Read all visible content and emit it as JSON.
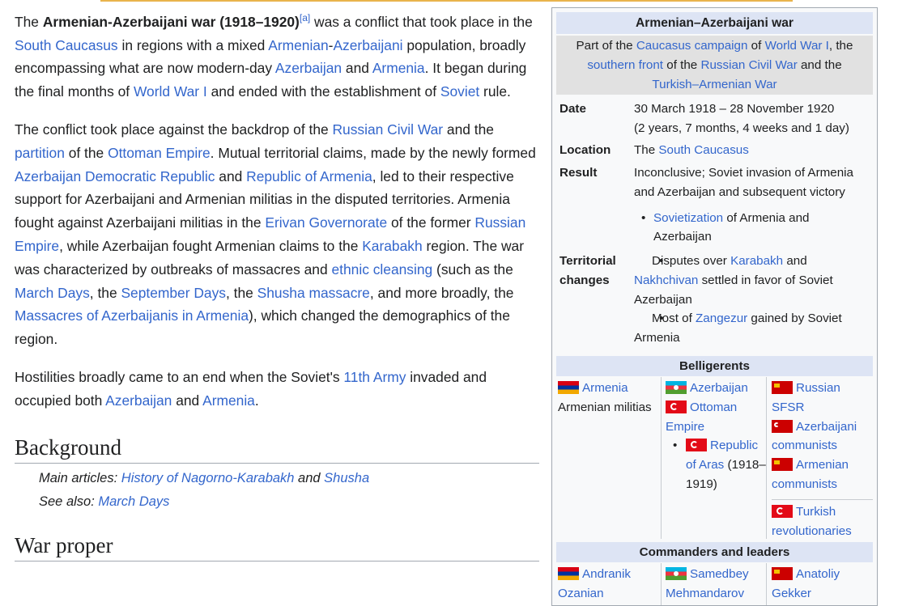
{
  "article": {
    "p1": {
      "t1": "The ",
      "bold": "Armenian-Azerbaijani war (1918–1920)",
      "note": "[a]",
      "t2": " was a conflict that took place in the ",
      "l_south_caucasus": "South Caucasus",
      "t3": " in regions with a mixed ",
      "l_armenian": "Armenian",
      "t4": "-",
      "l_azerbaijani": "Azerbaijani",
      "t5": " population, broadly encompassing what are now modern-day ",
      "l_azerbaijan": "Azerbaijan",
      "t6": " and ",
      "l_armenia": "Armenia",
      "t7": ". It began during the final months of ",
      "l_ww1": "World War I",
      "t8": " and ended with the establishment of ",
      "l_soviet": "Soviet",
      "t9": " rule."
    },
    "p2": {
      "t1": "The conflict took place against the backdrop of the ",
      "l_rcw": "Russian Civil War",
      "t2": " and the ",
      "l_partition": "partition",
      "t3": " of the ",
      "l_ottoman": "Ottoman Empire",
      "t4": ". Mutual territorial claims, made by the newly formed ",
      "l_adr": "Azerbaijan Democratic Republic",
      "t5": " and ",
      "l_roa": "Republic of Armenia",
      "t6": ", led to their respective support for Azerbaijani and Armenian militias in the disputed territories. Armenia fought against Azerbaijani militias in the ",
      "l_erivan": "Erivan Governorate",
      "t7": " of the former ",
      "l_rempire": "Russian Empire",
      "t8": ", while Azerbaijan fought Armenian claims to the ",
      "l_karabakh": "Karabakh",
      "t9": " region. The war was characterized by outbreaks of massacres and ",
      "l_ethnic": "ethnic cleansing",
      "t10": " (such as the ",
      "l_march": "March Days",
      "t11": ", the ",
      "l_september": "September Days",
      "t12": ", the ",
      "l_shusha": "Shusha massacre",
      "t13": ", and more broadly, the ",
      "l_massacres": "Massacres of Azerbaijanis in Armenia",
      "t14": "), which changed the demographics of the region."
    },
    "p3": {
      "t1": "Hostilities broadly came to an end when the Soviet's ",
      "l_11th": "11th Army",
      "t2": " invaded and occupied both ",
      "l_azerbaijan": "Azerbaijan",
      "t3": " and ",
      "l_armenia": "Armenia",
      "t4": "."
    },
    "background_heading": "Background",
    "main_articles": {
      "prefix": "Main articles: ",
      "l1": "History of Nagorno-Karabakh",
      "mid": " and ",
      "l2": "Shusha"
    },
    "see_also": {
      "prefix": "See also: ",
      "l1": "March Days"
    },
    "war_heading": "War proper"
  },
  "infobox": {
    "title": "Armenian–Azerbaijani war",
    "part_of": {
      "t1": "Part of the ",
      "l1": "Caucasus campaign",
      "t2": " of ",
      "l2": "World War I",
      "t3": ", the ",
      "l3": "southern front",
      "t4": " of the ",
      "l4": "Russian Civil War",
      "t5": " and the ",
      "l5": "Turkish–Armenian War"
    },
    "date_label": "Date",
    "date_value": "30 March 1918 – 28 November 1920",
    "date_duration": "(2 years, 7 months, 4 weeks and 1 day)",
    "location_label": "Location",
    "location_prefix": "The ",
    "location_link": "South Caucasus",
    "result_label": "Result",
    "result_value": "Inconclusive; Soviet invasion of Armenia and Azerbaijan and subsequent victory",
    "result_bullet_link": "Sovietization",
    "result_bullet_text": " of Armenia and Azerbaijan",
    "territorial_label": "Territorial changes",
    "territorial_b1_t1": "Disputes over ",
    "territorial_b1_l1": "Karabakh",
    "territorial_b1_t2": " and ",
    "territorial_b1_l2": "Nakhchivan",
    "territorial_b1_t3": " settled in favor of Soviet Azerbaijan",
    "territorial_b2_t1": "Most of ",
    "territorial_b2_l1": "Zangezur",
    "territorial_b2_t2": " gained by Soviet Armenia",
    "belligerents_header": "Belligerents",
    "bel_col1": {
      "armenia": "Armenia",
      "militias": "Armenian militias"
    },
    "bel_col2": {
      "azerbaijan": "Azerbaijan",
      "ottoman": "Ottoman Empire",
      "aras_link": "Republic of Aras",
      "aras_years": "(1918–1919)"
    },
    "bel_col3": {
      "rsfsr": "Russian SFSR",
      "az_communists": "Azerbaijani communists",
      "arm_communists": "Armenian communists",
      "turkish_rev": "Turkish revolutionaries"
    },
    "commanders_header": "Commanders and leaders",
    "cmd_col1": "Andranik Ozanian",
    "cmd_col2": "Samedbey Mehmandarov",
    "cmd_col3": "Anatoliy Gekker"
  },
  "colors": {
    "link": "#3366cc",
    "text": "#202122",
    "infobox_header": "#dde4f4",
    "infobox_subheader": "#e1e1e1"
  }
}
